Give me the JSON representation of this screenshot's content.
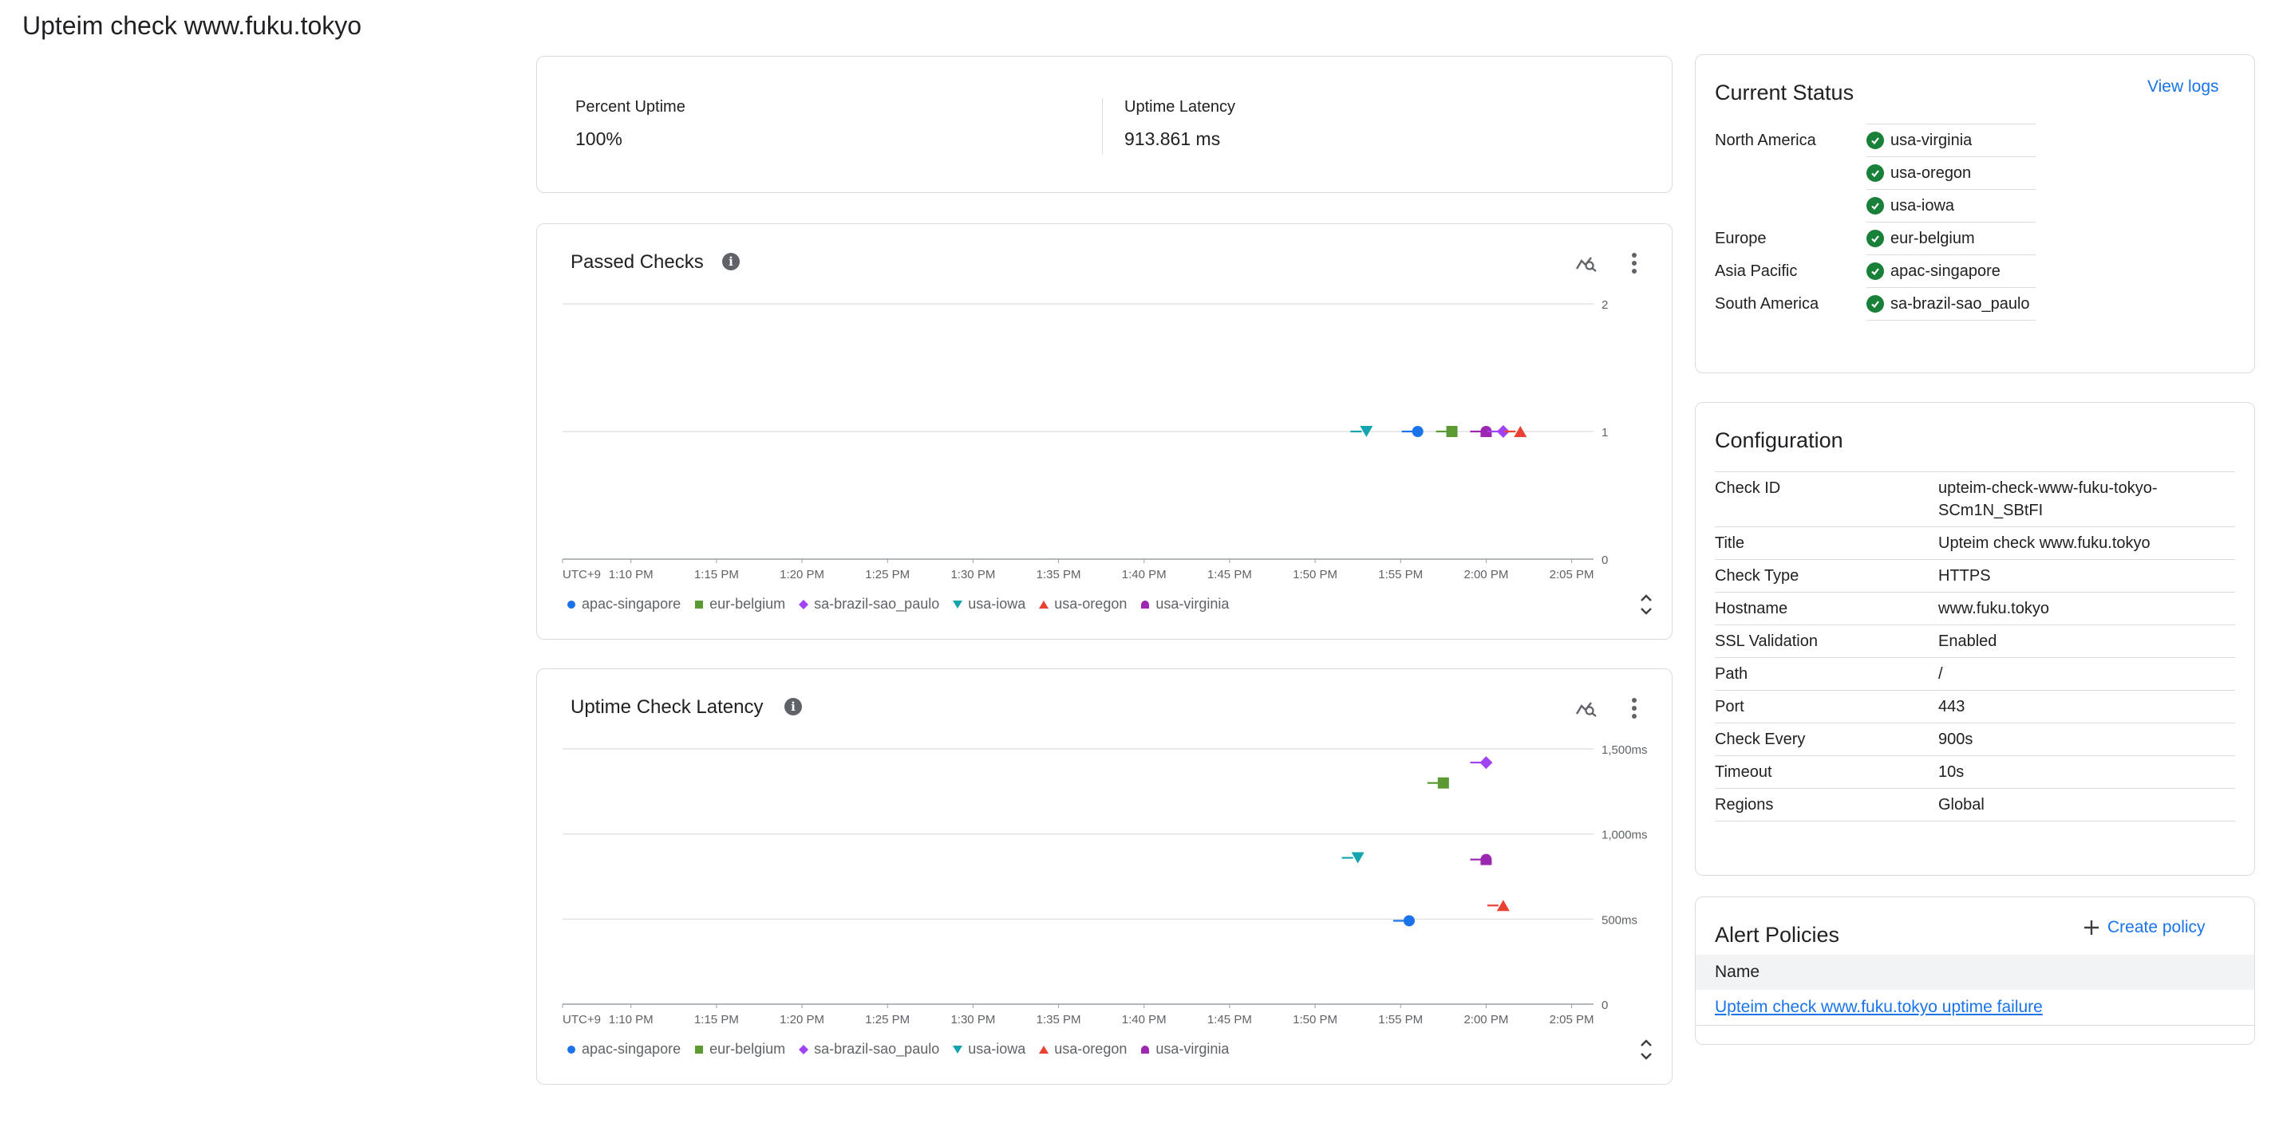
{
  "page": {
    "title": "Upteim check www.fuku.tokyo"
  },
  "summary": {
    "percent_uptime_label": "Percent Uptime",
    "percent_uptime_value": "100%",
    "latency_label": "Uptime Latency",
    "latency_value": "913.861 ms"
  },
  "colors": {
    "apac-singapore": "#1a73e8",
    "eur-belgium": "#5b9a32",
    "sa-brazil-sao_paulo": "#a142f4",
    "usa-iowa": "#12a4af",
    "usa-oregon": "#e94235",
    "usa-virginia": "#9c27b0"
  },
  "passed_checks": {
    "title": "Passed Checks",
    "chart_data": {
      "type": "scatter",
      "title": "Passed Checks",
      "ylim": [
        0,
        2
      ],
      "y_ticks": [
        "0",
        "1",
        "2"
      ],
      "x_ticks": [
        "UTC+9",
        "1:10 PM",
        "1:15 PM",
        "1:20 PM",
        "1:25 PM",
        "1:30 PM",
        "1:35 PM",
        "1:40 PM",
        "1:45 PM",
        "1:50 PM",
        "1:55 PM",
        "2:00 PM",
        "2:05 PM"
      ],
      "x_range_minutes": [
        66,
        126
      ],
      "grid": true,
      "legend": "bottom",
      "series": [
        {
          "name": "usa-iowa",
          "marker": "triangle-down",
          "points": [
            {
              "x": "1:53 PM",
              "y": 1
            }
          ]
        },
        {
          "name": "apac-singapore",
          "marker": "circle",
          "points": [
            {
              "x": "1:56 PM",
              "y": 1
            }
          ]
        },
        {
          "name": "eur-belgium",
          "marker": "square",
          "points": [
            {
              "x": "1:58 PM",
              "y": 1
            }
          ]
        },
        {
          "name": "usa-virginia",
          "marker": "semicircle",
          "points": [
            {
              "x": "2:00 PM",
              "y": 1
            }
          ]
        },
        {
          "name": "sa-brazil-sao_paulo",
          "marker": "diamond",
          "points": [
            {
              "x": "2:01 PM",
              "y": 1
            }
          ]
        },
        {
          "name": "usa-oregon",
          "marker": "triangle-up",
          "points": [
            {
              "x": "2:02 PM",
              "y": 1
            }
          ]
        }
      ]
    }
  },
  "latency_chart": {
    "title": "Uptime Check Latency",
    "chart_data": {
      "type": "scatter",
      "title": "Uptime Check Latency",
      "ylim": [
        0,
        1500
      ],
      "y_ticks": [
        "0",
        "500ms",
        "1,000ms",
        "1,500ms"
      ],
      "x_ticks": [
        "UTC+9",
        "1:10 PM",
        "1:15 PM",
        "1:20 PM",
        "1:25 PM",
        "1:30 PM",
        "1:35 PM",
        "1:40 PM",
        "1:45 PM",
        "1:50 PM",
        "1:55 PM",
        "2:00 PM",
        "2:05 PM"
      ],
      "x_range_minutes": [
        66,
        126
      ],
      "grid": true,
      "legend": "bottom",
      "series": [
        {
          "name": "usa-iowa",
          "marker": "triangle-down",
          "points": [
            {
              "x": "1:52.5 PM",
              "y": 860
            }
          ]
        },
        {
          "name": "apac-singapore",
          "marker": "circle",
          "points": [
            {
              "x": "1:55.5 PM",
              "y": 490
            }
          ]
        },
        {
          "name": "eur-belgium",
          "marker": "square",
          "points": [
            {
              "x": "1:57.5 PM",
              "y": 1300
            }
          ]
        },
        {
          "name": "usa-virginia",
          "marker": "semicircle",
          "points": [
            {
              "x": "2:00 PM",
              "y": 850
            }
          ]
        },
        {
          "name": "sa-brazil-sao_paulo",
          "marker": "diamond",
          "points": [
            {
              "x": "2:00 PM",
              "y": 1420
            }
          ]
        },
        {
          "name": "usa-oregon",
          "marker": "triangle-up",
          "points": [
            {
              "x": "2:01 PM",
              "y": 580
            }
          ]
        }
      ]
    }
  },
  "legend_items": [
    {
      "name": "apac-singapore",
      "marker": "circle"
    },
    {
      "name": "eur-belgium",
      "marker": "square"
    },
    {
      "name": "sa-brazil-sao_paulo",
      "marker": "diamond"
    },
    {
      "name": "usa-iowa",
      "marker": "triangle-down"
    },
    {
      "name": "usa-oregon",
      "marker": "triangle-up"
    },
    {
      "name": "usa-virginia",
      "marker": "semicircle"
    }
  ],
  "current_status": {
    "title": "Current Status",
    "view_logs": "View logs",
    "regions": [
      {
        "region": "North America",
        "locations": [
          "usa-virginia",
          "usa-oregon",
          "usa-iowa"
        ]
      },
      {
        "region": "Europe",
        "locations": [
          "eur-belgium"
        ]
      },
      {
        "region": "Asia Pacific",
        "locations": [
          "apac-singapore"
        ]
      },
      {
        "region": "South America",
        "locations": [
          "sa-brazil-sao_paulo"
        ]
      }
    ]
  },
  "configuration": {
    "title": "Configuration",
    "rows": [
      {
        "key": "Check ID",
        "value": "upteim-check-www-fuku-tokyo-SCm1N_SBtFI"
      },
      {
        "key": "Title",
        "value": "Upteim check www.fuku.tokyo"
      },
      {
        "key": "Check Type",
        "value": "HTTPS"
      },
      {
        "key": "Hostname",
        "value": "www.fuku.tokyo"
      },
      {
        "key": "SSL Validation",
        "value": "Enabled"
      },
      {
        "key": "Path",
        "value": "/"
      },
      {
        "key": "Port",
        "value": "443"
      },
      {
        "key": "Check Every",
        "value": "900s"
      },
      {
        "key": "Timeout",
        "value": "10s"
      },
      {
        "key": "Regions",
        "value": "Global"
      }
    ]
  },
  "alert_policies": {
    "title": "Alert Policies",
    "create_label": "Create policy",
    "column_name": "Name",
    "policies": [
      "Upteim check www.fuku.tokyo uptime failure"
    ]
  }
}
